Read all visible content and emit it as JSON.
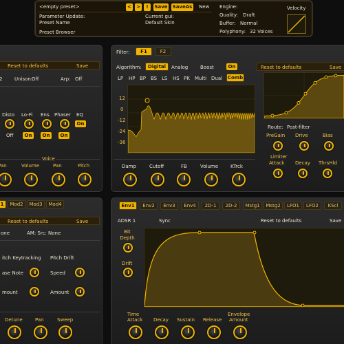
{
  "header": {
    "preset_name": "<empty preset>",
    "nav_buttons": [
      "<",
      ">",
      "!"
    ],
    "save_label": "Save",
    "save_as_label": "SaveAs",
    "new_label": "New",
    "param_update_label": "Parameter Update:",
    "param_update_value": "Preset Name",
    "current_gui_label": "Current gui:",
    "current_gui_value": "Default Skin",
    "preset_browser_label": "Preset Browser",
    "engine_label": "Engine:",
    "quality_label": "Quality:",
    "quality_value": "Draft",
    "buffer_label": "Buffer:",
    "buffer_value": "Normal",
    "polyphony_label": "Polyphony:",
    "polyphony_value": "32 Voices",
    "velocity_label": "Velocity"
  },
  "left_top": {
    "reset_label": "Reset to defaults",
    "save_label": "Save",
    "unison_label": "Unison:",
    "unison_value": "Off",
    "arp_label": "Arp:",
    "arp_value": "Off",
    "field2_value": "2",
    "fx_labels": [
      "Disto",
      "Lo-Fi",
      "Ens.",
      "Phaser",
      "EQ"
    ],
    "fx_toggles": [
      "Off",
      "On",
      "On",
      "On",
      "On"
    ],
    "voice_label": "Voice",
    "knob_labels": [
      "Pan",
      "Volume",
      "Pan",
      "Pitch"
    ]
  },
  "filter": {
    "filter_label": "Filter:",
    "tabs": [
      "F1",
      "F2"
    ],
    "algorithm_label": "Algorithm:",
    "algorithms": [
      "Digital",
      "Analog"
    ],
    "boost_label": "Boost",
    "boost_value": "On",
    "types": [
      "LP",
      "HP",
      "BP",
      "BS",
      "LS",
      "HS",
      "PK",
      "Multi",
      "Dual",
      "Comb"
    ],
    "y_ticks": [
      "12",
      "0",
      "-12",
      "-24",
      "-36"
    ],
    "reset_label": "Reset to defaults",
    "save_label": "Save",
    "route_label": "Route:",
    "route_value": "Post-filter",
    "shaper_knobs": [
      "PreGain",
      "Drive",
      "Bias"
    ],
    "limiter_label": "Limiter",
    "limiter_knobs": [
      "Attack",
      "Decay",
      "ThrsHld"
    ],
    "knob_labels": [
      "Damp",
      "Cutoff",
      "FB",
      "Volume",
      "KTrck"
    ]
  },
  "left_bottom": {
    "tabs": [
      "1",
      "Mod2",
      "Mod3",
      "Mod4"
    ],
    "reset_label": "Reset to defaults",
    "save_label": "Save",
    "src_label": "one",
    "am_label": "AM: Src: None",
    "pitch_keytracking_label": "itch Keytracking",
    "pitch_drift_label": "Pitch Drift",
    "base_note_label": "ase Note",
    "speed_label": "Speed",
    "amount_label_1": "mount",
    "amount_label_2": "Amount",
    "knob_labels": [
      "Detune",
      "Pan",
      "Sweep"
    ]
  },
  "env": {
    "tabs": [
      "Env1",
      "Env2",
      "Env3",
      "Env4",
      "2D-1",
      "2D-2",
      "Mstg1",
      "Mstg2",
      "LFO1",
      "LFO2",
      "KScl"
    ],
    "adsr_label": "ADSR 1",
    "sync_label": "Sync",
    "reset_label": "Reset to defaults",
    "save_label": "Save",
    "bit_depth_label": "Bit Depth",
    "drift_label": "Drift",
    "time_label": "Time",
    "envelope_label": "Envelope",
    "knob_labels": [
      "Attack",
      "Decay",
      "Sustain",
      "Release",
      "Amount"
    ]
  },
  "colors": {
    "accent": "#f0b400",
    "panel": "#262626",
    "display_bg": "#1e1a0c",
    "curve": "#e6b020"
  }
}
